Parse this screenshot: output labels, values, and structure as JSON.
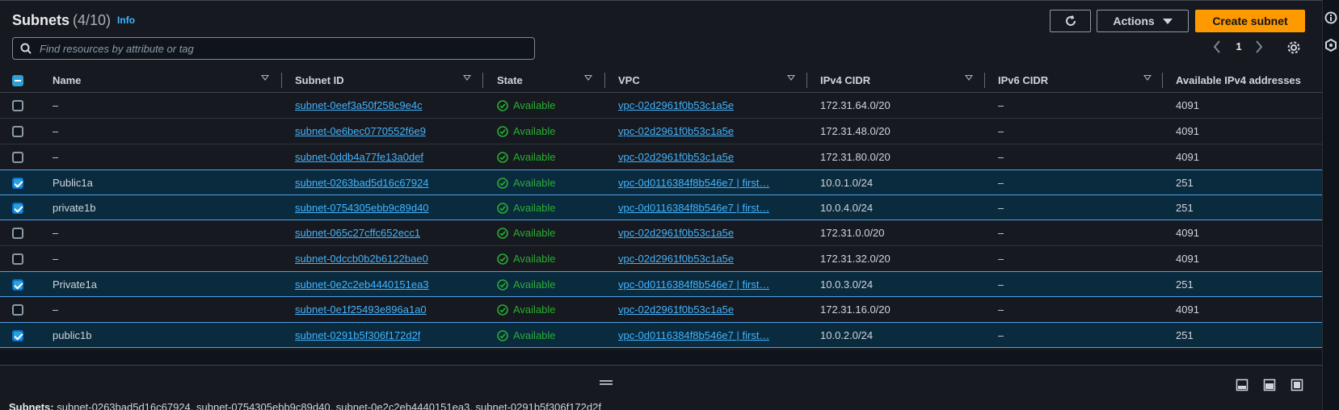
{
  "header": {
    "title": "Subnets",
    "count": "(4/10)",
    "info": "Info",
    "actions_label": "Actions",
    "create_label": "Create subnet"
  },
  "search": {
    "placeholder": "Find resources by attribute or tag"
  },
  "pagination": {
    "page": "1"
  },
  "columns": [
    "Name",
    "Subnet ID",
    "State",
    "VPC",
    "IPv4 CIDR",
    "IPv6 CIDR",
    "Available IPv4 addresses"
  ],
  "rows": [
    {
      "selected": false,
      "name": "–",
      "subnet_id": "subnet-0eef3a50f258c9e4c",
      "state": "Available",
      "vpc": "vpc-02d2961f0b53c1a5e",
      "ipv4": "172.31.64.0/20",
      "ipv6": "–",
      "available": "4091"
    },
    {
      "selected": false,
      "name": "–",
      "subnet_id": "subnet-0e6bec0770552f6e9",
      "state": "Available",
      "vpc": "vpc-02d2961f0b53c1a5e",
      "ipv4": "172.31.48.0/20",
      "ipv6": "–",
      "available": "4091"
    },
    {
      "selected": false,
      "name": "–",
      "subnet_id": "subnet-0ddb4a77fe13a0def",
      "state": "Available",
      "vpc": "vpc-02d2961f0b53c1a5e",
      "ipv4": "172.31.80.0/20",
      "ipv6": "–",
      "available": "4091"
    },
    {
      "selected": true,
      "name": "Public1a",
      "subnet_id": "subnet-0263bad5d16c67924",
      "state": "Available",
      "vpc": "vpc-0d0116384f8b546e7 | first…",
      "ipv4": "10.0.1.0/24",
      "ipv6": "–",
      "available": "251"
    },
    {
      "selected": true,
      "name": "private1b",
      "subnet_id": "subnet-0754305ebb9c89d40",
      "state": "Available",
      "vpc": "vpc-0d0116384f8b546e7 | first…",
      "ipv4": "10.0.4.0/24",
      "ipv6": "–",
      "available": "251"
    },
    {
      "selected": false,
      "name": "–",
      "subnet_id": "subnet-065c27cffc652ecc1",
      "state": "Available",
      "vpc": "vpc-02d2961f0b53c1a5e",
      "ipv4": "172.31.0.0/20",
      "ipv6": "–",
      "available": "4091"
    },
    {
      "selected": false,
      "name": "–",
      "subnet_id": "subnet-0dccb0b2b6122bae0",
      "state": "Available",
      "vpc": "vpc-02d2961f0b53c1a5e",
      "ipv4": "172.31.32.0/20",
      "ipv6": "–",
      "available": "4091"
    },
    {
      "selected": true,
      "name": "Private1a",
      "subnet_id": "subnet-0e2c2eb4440151ea3",
      "state": "Available",
      "vpc": "vpc-0d0116384f8b546e7 | first…",
      "ipv4": "10.0.3.0/24",
      "ipv6": "–",
      "available": "251"
    },
    {
      "selected": false,
      "name": "–",
      "subnet_id": "subnet-0e1f25493e896a1a0",
      "state": "Available",
      "vpc": "vpc-02d2961f0b53c1a5e",
      "ipv4": "172.31.16.0/20",
      "ipv6": "–",
      "available": "4091"
    },
    {
      "selected": true,
      "name": "public1b",
      "subnet_id": "subnet-0291b5f306f172d2f",
      "state": "Available",
      "vpc": "vpc-0d0116384f8b546e7 | first…",
      "ipv4": "10.0.2.0/24",
      "ipv6": "–",
      "available": "251"
    }
  ],
  "footer": {
    "summary_label": "Subnets:",
    "summary_value": "subnet-0263bad5d16c67924, subnet-0754305ebb9c89d40, subnet-0e2c2eb4440151ea3, subnet-0291b5f306f172d2f"
  },
  "icons": {
    "search": "search-icon",
    "refresh": "refresh-icon",
    "settings": "gear-icon",
    "prev": "chevron-left-icon",
    "next": "chevron-right-icon",
    "state": "check-circle-icon"
  },
  "colors": {
    "accent": "#ff9900",
    "link": "#42b4ff",
    "success": "#29ad32",
    "selected_row": "#0a2a3e"
  }
}
